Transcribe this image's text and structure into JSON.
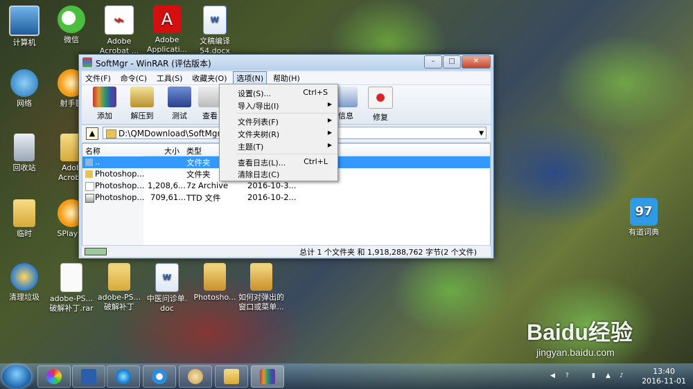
{
  "desktop_icons": {
    "computer": "计算机",
    "wechat": "微信",
    "adobe_acrobat": "Adobe\nAcrobat ...",
    "adobe_app": "Adobe\nApplicati...",
    "docx_file": "文稿编译\n54.docx",
    "network": "网络",
    "shooter": "射手影",
    "recycle_bin": "回收站",
    "adobe_acrobat2": "Adob\nAcroba",
    "temp": "临时",
    "splayer": "SPlayer",
    "youdao": "有道词典",
    "clean": "清理垃圾",
    "rar_file": "adobe-PS...\n破解补丁.rar",
    "patch_folder": "adobe-PS...\n破解补丁",
    "doc_file": "中医问诊单.\ndoc",
    "photoshop": "Photosho...",
    "popup_folder": "如何对弹出的\n窗口或菜单..."
  },
  "window": {
    "title": "SoftMgr - WinRAR (评估版本)",
    "min": "–",
    "max": "□",
    "close": "✕",
    "menu": [
      "文件(F)",
      "命令(C)",
      "工具(S)",
      "收藏夹(O)",
      "选项(N)",
      "帮助(H)"
    ],
    "toolbar": [
      "添加",
      "解压到",
      "测试",
      "查看",
      "信息",
      "修复"
    ],
    "address": "D:\\QMDownload\\SoftMgr",
    "columns": {
      "name": "名称",
      "size": "大小",
      "type": "类型"
    },
    "rows": [
      {
        "name": "..",
        "size": "",
        "type": "文件夹",
        "date": ""
      },
      {
        "name": "Photoshop...",
        "size": "",
        "type": "文件夹",
        "date": ""
      },
      {
        "name": "Photoshop...",
        "size": "1,208,6...",
        "type": "7z Archive",
        "date": "2016-10-3..."
      },
      {
        "name": "Photoshop...",
        "size": "709,61...",
        "type": "TTD 文件",
        "date": "2016-10-2..."
      }
    ],
    "status": "总计 1 个文件夹 和 1,918,288,762 字节(2 个文件)"
  },
  "options_menu": [
    {
      "label": "设置(S)...",
      "shortcut": "Ctrl+S"
    },
    {
      "label": "导入/导出(I)",
      "submenu": true
    },
    {
      "label": "文件列表(F)",
      "submenu": true
    },
    {
      "label": "文件夹树(R)",
      "submenu": true
    },
    {
      "label": "主题(T)",
      "submenu": true
    },
    {
      "label": "查看日志(L)...",
      "shortcut": "Ctrl+L"
    },
    {
      "label": "清除日志(C)"
    }
  ],
  "tray": {
    "time": "13:40",
    "date": "2016-11-01"
  },
  "watermark": {
    "brand": "Baidu经验",
    "url": "jingyan.baidu.com"
  },
  "colors": {
    "selection": "#3399ff",
    "menu_bg": "#f0f0f0",
    "title_bg": "#c9dbef"
  }
}
